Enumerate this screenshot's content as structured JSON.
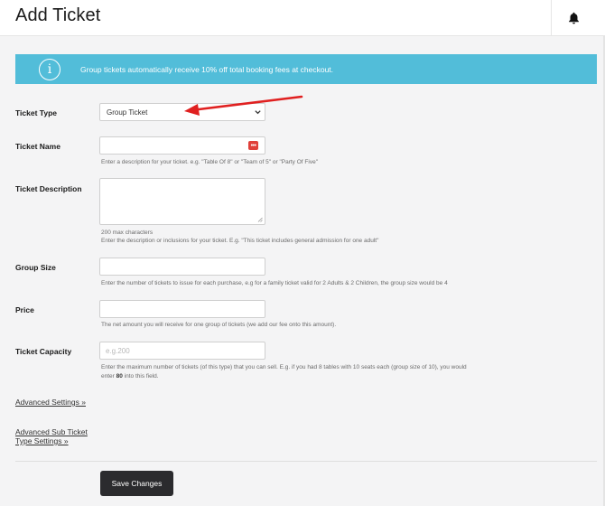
{
  "header": {
    "title": "Add Ticket",
    "bell_icon": "bell-icon"
  },
  "banner": {
    "icon": "info-icon",
    "icon_glyph": "i",
    "text": "Group tickets automatically receive 10% off total booking fees at checkout.",
    "color": "#52bdd9"
  },
  "form": {
    "ticket_type": {
      "label": "Ticket Type",
      "value": "Group Ticket"
    },
    "ticket_name": {
      "label": "Ticket Name",
      "value": "",
      "help": "Enter a description for your ticket. e.g. \"Table Of 8\" or \"Team of 5\" or \"Party Of Five\""
    },
    "ticket_description": {
      "label": "Ticket Description",
      "value": "",
      "max_chars": "200 max characters",
      "help": "Enter the description or inclusions for your ticket. E.g. \"This ticket includes general admission for one adult\""
    },
    "group_size": {
      "label": "Group Size",
      "value": "",
      "help": "Enter the number of tickets to issue for each purchase, e.g for a family ticket valid for 2 Adults & 2 Children, the group size would be 4"
    },
    "price": {
      "label": "Price",
      "value": "",
      "help": "The net amount you will receive for one group of tickets (we add our fee onto this amount)."
    },
    "ticket_capacity": {
      "label": "Ticket Capacity",
      "placeholder": "e.g.200",
      "help_line1": "Enter the maximum number of tickets (of this type) that you can sell. E.g. if you had 8 tables with 10 seats each (group size of 10), you would",
      "help_line2_pre": "enter ",
      "help_line2_bold": "80",
      "help_line2_post": " into this field."
    }
  },
  "links": {
    "advanced_settings": "Advanced Settings »",
    "advanced_sub_ticket_line1": "Advanced Sub Ticket",
    "advanced_sub_ticket_line2": "Type Settings »"
  },
  "actions": {
    "save_label": "Save Changes"
  },
  "colors": {
    "annotation_arrow": "#e02020",
    "save_button": "#2b2b2e",
    "password_icon": "#e0403a"
  }
}
